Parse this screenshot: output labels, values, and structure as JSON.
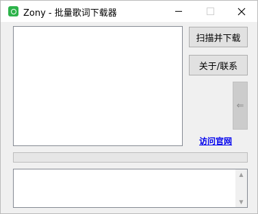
{
  "window": {
    "title": "Zony - 批量歌词下载器",
    "controls": {
      "minimize": "minimize",
      "maximize": "maximize",
      "close": "close"
    }
  },
  "buttons": {
    "scan_download": "扫描并下载",
    "about_contact": "关于/联系",
    "collapse_arrow": "⇐"
  },
  "link": {
    "visit_site": "访问官网"
  },
  "progress": {
    "value": 0
  },
  "icons": {
    "app": "app-icon",
    "scroll_up": "▲",
    "scroll_down": "▼"
  },
  "colors": {
    "accent": "#2db34a",
    "link": "#0000ee"
  }
}
